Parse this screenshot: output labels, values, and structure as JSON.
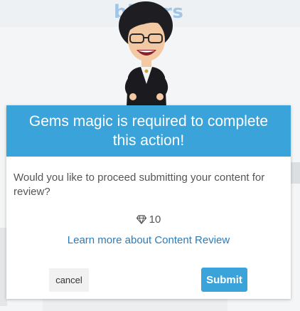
{
  "background": {
    "logo_text": "bitlers"
  },
  "modal": {
    "title": "Gems magic is required to complete this action!",
    "message": "Would you like to proceed submitting your content for review?",
    "gem_cost": "10",
    "gem_icon": "diamond-icon",
    "learn_more_label": "Learn more about Content Review",
    "cancel_label": "cancel",
    "submit_label": "Submit"
  },
  "colors": {
    "accent": "#3aa3d9",
    "link": "#2b7bb9"
  }
}
